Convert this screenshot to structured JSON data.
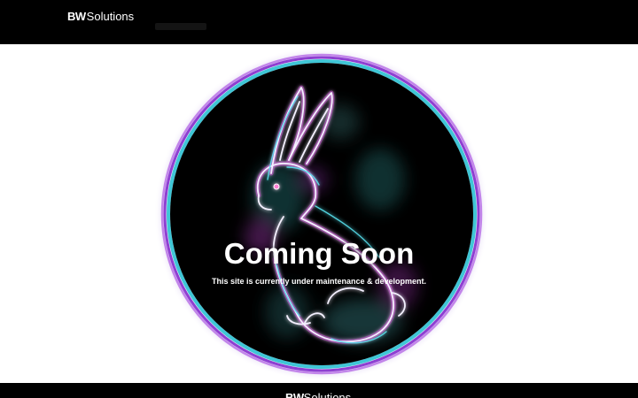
{
  "header": {
    "logo_bold": "BW",
    "logo_light": "Solutions"
  },
  "hero": {
    "title": "Coming Soon",
    "subtitle": "This site is currently under maintenance & development.",
    "image_icon": "neon-rabbit-illustration",
    "colors": {
      "ring_outer": "#8e3fd1",
      "ring_inner": "#3fc6d6",
      "background": "#000000"
    }
  },
  "footer": {
    "logo_bold": "BW",
    "logo_light": "Solutions"
  }
}
